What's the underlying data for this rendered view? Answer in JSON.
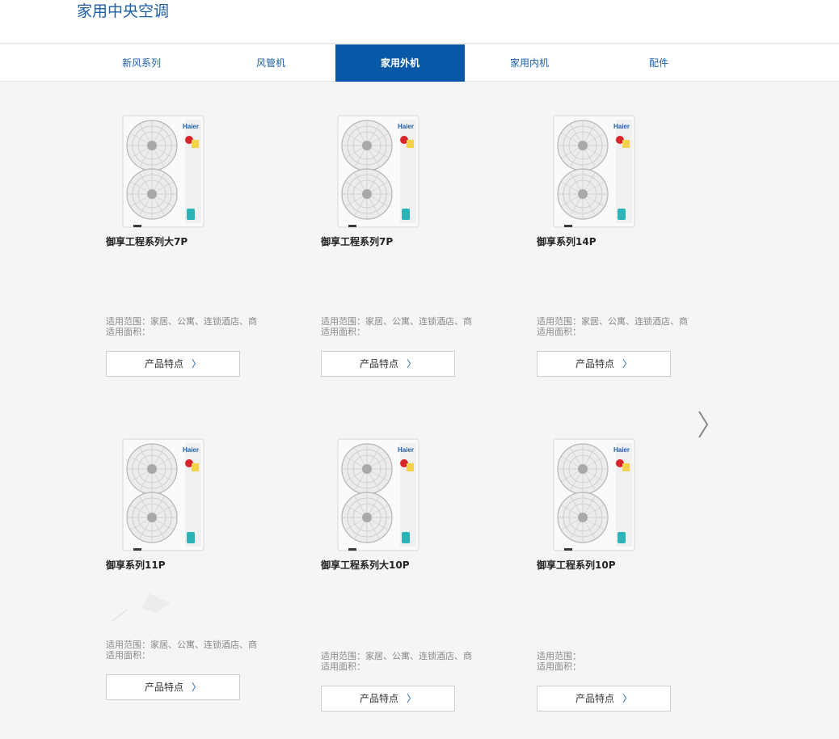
{
  "header": {
    "title": "家用中央空调"
  },
  "tabs": [
    {
      "label": "新风系列",
      "active": false
    },
    {
      "label": "风管机",
      "active": false
    },
    {
      "label": "家用外机",
      "active": true
    },
    {
      "label": "家用内机",
      "active": false
    },
    {
      "label": "配件",
      "active": false
    }
  ],
  "common": {
    "brand_text": "Haier",
    "button_label": "产品特点",
    "chevron": "〉",
    "next_icon": "chevron-right-icon"
  },
  "products": [
    {
      "name": "御享工程系列大7P",
      "scope": "适用范围：家居、公寓、连锁酒店、商",
      "area": "适用面积："
    },
    {
      "name": "御享工程系列7P",
      "scope": "适用范围：家居、公寓、连锁酒店、商",
      "area": "适用面积："
    },
    {
      "name": "御享系列14P",
      "scope": "适用范围：家居、公寓、连锁酒店、商",
      "area": "适用面积："
    },
    {
      "name": "御享系列11P",
      "scope": "适用范围：家居、公寓、连锁酒店、商",
      "area": "适用面积："
    },
    {
      "name": "御享工程系列大10P",
      "scope": "适用范围：家居、公寓、连锁酒店、商",
      "area": "适用面积："
    },
    {
      "name": "御享工程系列10P",
      "scope": "适用范围：",
      "area": "适用面积："
    }
  ],
  "colors": {
    "accent": "#0858a8",
    "link": "#1e5fa8",
    "background": "#f5f5f5"
  }
}
